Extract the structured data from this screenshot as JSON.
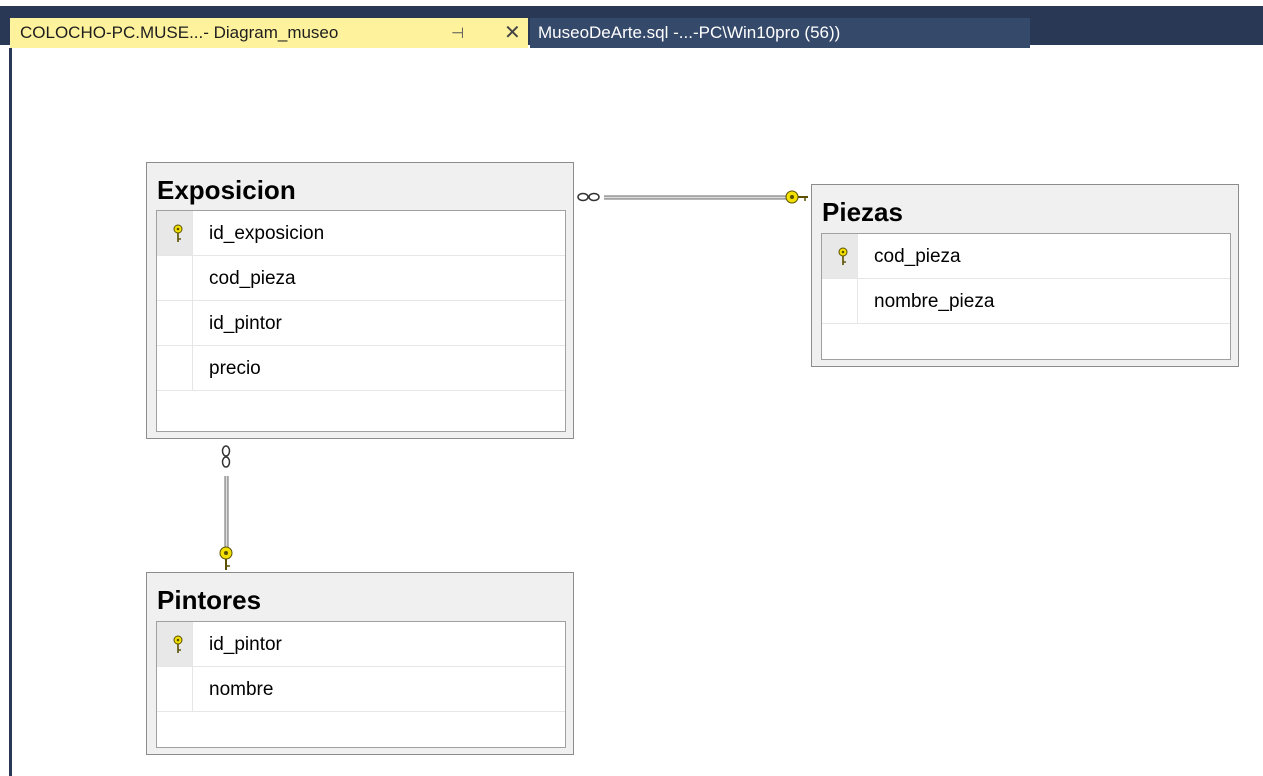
{
  "tabs": {
    "active": {
      "label": "COLOCHO-PC.MUSE...- Diagram_museo",
      "pin_icon": "pin-icon",
      "close_icon": "close-icon"
    },
    "inactive": {
      "label": "MuseoDeArte.sql -...-PC\\Win10pro (56))"
    }
  },
  "tables": {
    "exposicion": {
      "title": "Exposicion",
      "columns": [
        {
          "name": "id_exposicion",
          "primary_key": true
        },
        {
          "name": "cod_pieza",
          "primary_key": false
        },
        {
          "name": "id_pintor",
          "primary_key": false
        },
        {
          "name": "precio",
          "primary_key": false
        }
      ]
    },
    "piezas": {
      "title": "Piezas",
      "columns": [
        {
          "name": "cod_pieza",
          "primary_key": true
        },
        {
          "name": "nombre_pieza",
          "primary_key": false
        }
      ]
    },
    "pintores": {
      "title": "Pintores",
      "columns": [
        {
          "name": "id_pintor",
          "primary_key": true
        },
        {
          "name": "nombre",
          "primary_key": false
        }
      ]
    }
  },
  "relationships": [
    {
      "from": "Exposicion",
      "to": "Piezas",
      "from_end": "many",
      "to_end": "one"
    },
    {
      "from": "Exposicion",
      "to": "Pintores",
      "from_end": "many",
      "to_end": "one"
    }
  ],
  "colors": {
    "tab_active": "#fff29d",
    "tab_bar": "#293955",
    "key": "#f2e000"
  }
}
